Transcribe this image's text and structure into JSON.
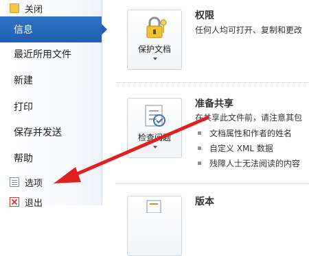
{
  "nav": {
    "close": "关闭",
    "info": "信息",
    "recent": "最近所用文件",
    "new": "新建",
    "print": "打印",
    "save_send": "保存并发送",
    "help": "帮助",
    "options": "选项",
    "exit": "退出"
  },
  "permissions": {
    "title": "权限",
    "description": "任何人均可打开、复制和更改",
    "button_label": "保护文档"
  },
  "prepare": {
    "title": "准备共享",
    "description": "在共享此文件前，请注意其包",
    "button_label": "检查问题",
    "items": [
      "文档属性和作者的姓名",
      "自定义 XML 数据",
      "残障人士无法阅读的内容"
    ]
  },
  "versions": {
    "title": "版本"
  },
  "colors": {
    "active_nav": "#1f5fb2",
    "arrow": "#e02020"
  }
}
